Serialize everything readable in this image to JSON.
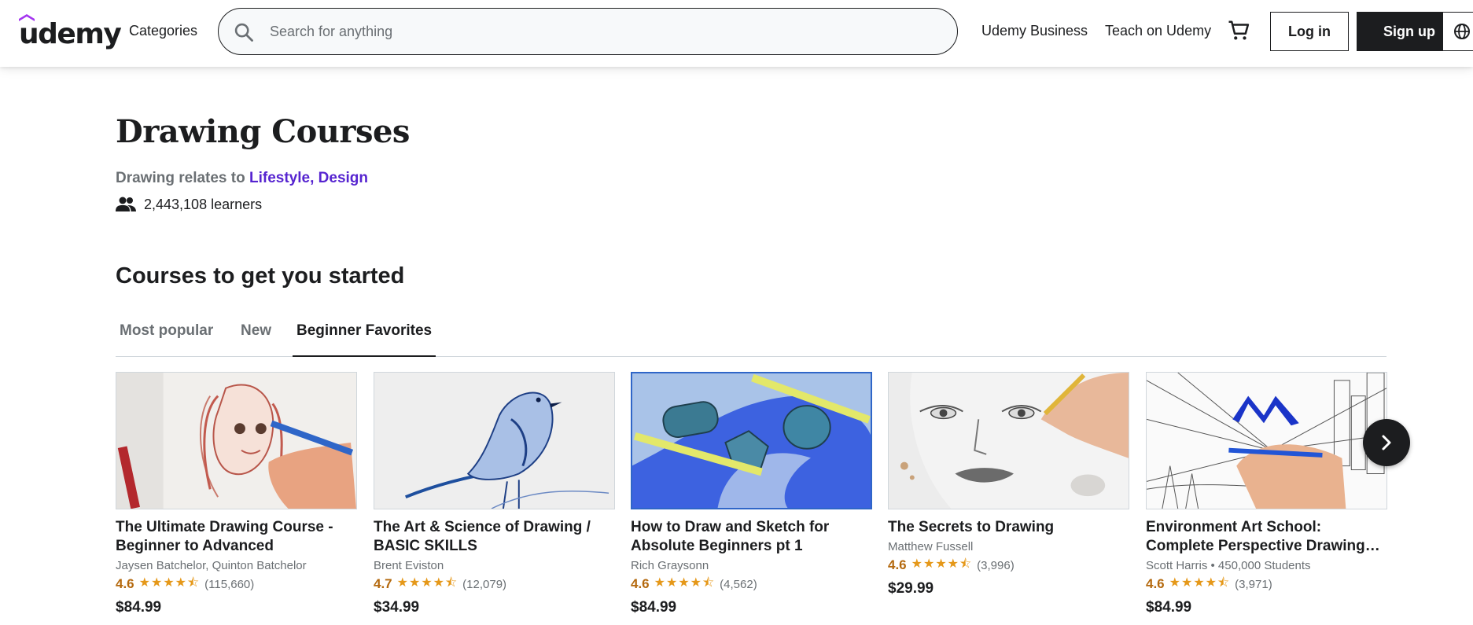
{
  "header": {
    "logo_text": "udemy",
    "categories_label": "Categories",
    "search_placeholder": "Search for anything",
    "business_label": "Udemy Business",
    "teach_label": "Teach on Udemy",
    "login_label": "Log in",
    "signup_label": "Sign up"
  },
  "topic": {
    "title": "Drawing Courses",
    "relates_prefix": "Drawing relates to",
    "related": [
      "Lifestyle",
      "Design"
    ],
    "learners": "2,443,108 learners"
  },
  "section": {
    "title": "Courses to get you started",
    "tabs": [
      "Most popular",
      "New",
      "Beginner Favorites"
    ],
    "active_tab": "Beginner Favorites"
  },
  "courses": [
    {
      "title": "The Ultimate Drawing Course - Beginner to Advanced",
      "author": "Jaysen Batchelor, Quinton Batchelor",
      "rating": "4.6",
      "rating_value": 4.6,
      "reviews": "(115,660)",
      "price": "$84.99"
    },
    {
      "title": "The Art & Science of Drawing / BASIC SKILLS",
      "author": "Brent Eviston",
      "rating": "4.7",
      "rating_value": 4.7,
      "reviews": "(12,079)",
      "price": "$34.99"
    },
    {
      "title": "How to Draw and Sketch for Absolute Beginners pt 1",
      "author": "Rich Graysonn",
      "rating": "4.6",
      "rating_value": 4.6,
      "reviews": "(4,562)",
      "price": "$84.99"
    },
    {
      "title": "The Secrets to Drawing",
      "author": "Matthew Fussell",
      "rating": "4.6",
      "rating_value": 4.6,
      "reviews": "(3,996)",
      "price": "$29.99"
    },
    {
      "title": "Environment Art School: Complete Perspective Drawing Course",
      "author": "Scott Harris • 450,000 Students",
      "rating": "4.6",
      "rating_value": 4.6,
      "reviews": "(3,971)",
      "price": "$84.99"
    }
  ],
  "colors": {
    "brand_purple": "#a435f0",
    "link_purple": "#5624d0",
    "rating_orange": "#b4690e",
    "star_gold": "#e59819",
    "dark": "#1c1d1f"
  },
  "icons": {
    "search": "search-icon",
    "cart": "cart-icon",
    "globe": "globe-icon",
    "learners": "people-icon",
    "next": "chevron-right-icon"
  }
}
